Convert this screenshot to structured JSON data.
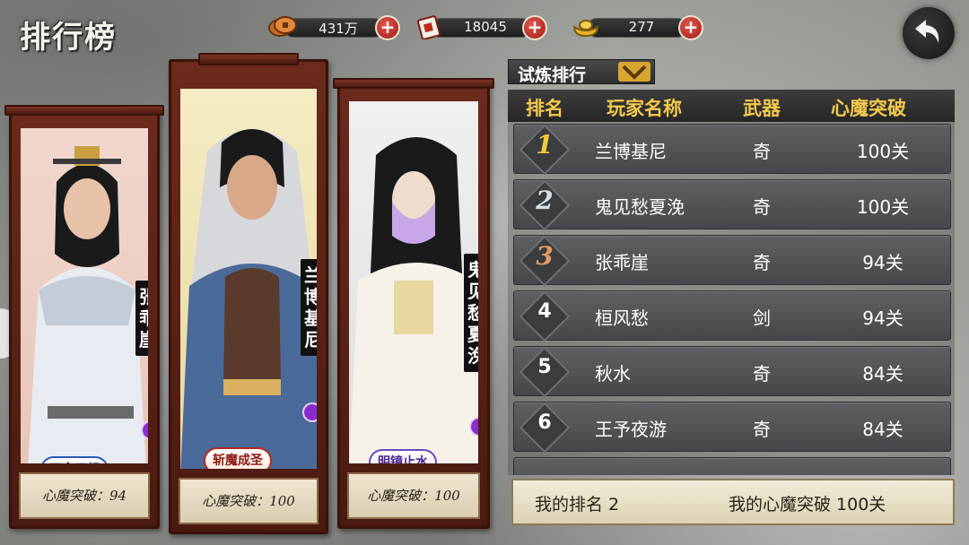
{
  "page_title": "排行榜",
  "currencies": [
    {
      "icon": "copper-coins-icon",
      "value": "431万"
    },
    {
      "icon": "scroll-token-icon",
      "value": "18045"
    },
    {
      "icon": "gold-ingot-icon",
      "value": "277"
    }
  ],
  "dropdown": {
    "label": "试炼排行"
  },
  "table": {
    "headers": {
      "rank": "排名",
      "name": "玩家名称",
      "weapon": "武器",
      "stage": "心魔突破"
    },
    "rows": [
      {
        "rank": "1",
        "name": "兰博基尼",
        "weapon": "奇",
        "stage": "100关"
      },
      {
        "rank": "2",
        "name": "鬼见愁夏浼",
        "weapon": "奇",
        "stage": "100关"
      },
      {
        "rank": "3",
        "name": "张乖崖",
        "weapon": "奇",
        "stage": "94关"
      },
      {
        "rank": "4",
        "name": "桓风愁",
        "weapon": "剑",
        "stage": "94关"
      },
      {
        "rank": "5",
        "name": "秋水",
        "weapon": "奇",
        "stage": "84关"
      },
      {
        "rank": "6",
        "name": "王予夜游",
        "weapon": "奇",
        "stage": "84关"
      }
    ]
  },
  "my_rank": {
    "rank_text": "我的排名 2",
    "stage_text": "我的心魔突破 100关"
  },
  "podium": [
    {
      "name": "张乖崖",
      "title": "无念无想",
      "footer": "心魔突破：94"
    },
    {
      "name": "兰博基尼",
      "title": "斩魔成圣",
      "footer": "心魔突破：100"
    },
    {
      "name": "鬼见愁夏浼",
      "title": "明镜止水",
      "footer": "心魔突破：100"
    }
  ],
  "colors": {
    "gold": "#f2c94c",
    "scroll_frame": "#5a2114",
    "plus_button": "#c0302a"
  }
}
